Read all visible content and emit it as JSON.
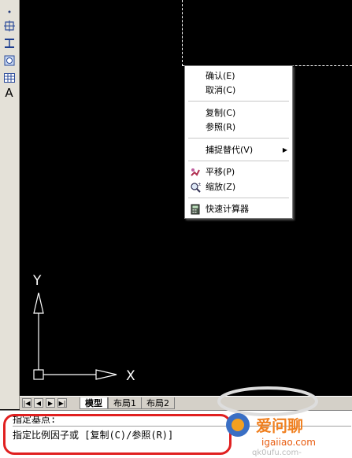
{
  "toolbar": {
    "tools": [
      {
        "icon": "dot-icon"
      },
      {
        "icon": "dimension-icon"
      },
      {
        "icon": "dimension-alt-icon"
      },
      {
        "icon": "region-icon"
      },
      {
        "icon": "table-icon"
      },
      {
        "icon": "text-icon",
        "glyph": "A"
      }
    ]
  },
  "context_menu": {
    "items": [
      {
        "label": "确认(E)"
      },
      {
        "label": "取消(C)"
      },
      {
        "label": "复制(C)"
      },
      {
        "label": "参照(R)"
      },
      {
        "label": "捕捉替代(V)",
        "submenu": "▶"
      },
      {
        "label": "平移(P)",
        "icon": "pan-icon"
      },
      {
        "label": "缩放(Z)",
        "icon": "zoom-icon"
      },
      {
        "label": "快速计算器",
        "icon": "calculator-icon"
      }
    ]
  },
  "ucs": {
    "y_label": "Y",
    "x_label": "X"
  },
  "tabs": {
    "nav": [
      "|◀",
      "◀",
      "▶",
      "▶|"
    ],
    "items": [
      {
        "label": "模型",
        "active": true
      },
      {
        "label": "布局1",
        "active": false
      },
      {
        "label": "布局2",
        "active": false
      }
    ]
  },
  "command": {
    "line1": "指定基点:",
    "line2": "指定比例因子或 [复制(C)/参照(R)]"
  },
  "watermark": {
    "brand": "爱问聊",
    "site": "igaiiao.com",
    "partial": "qk0ufu.com-"
  },
  "colors": {
    "highlight": "#e02020",
    "canvas": "#000000",
    "menu_bg": "#ffffff"
  }
}
